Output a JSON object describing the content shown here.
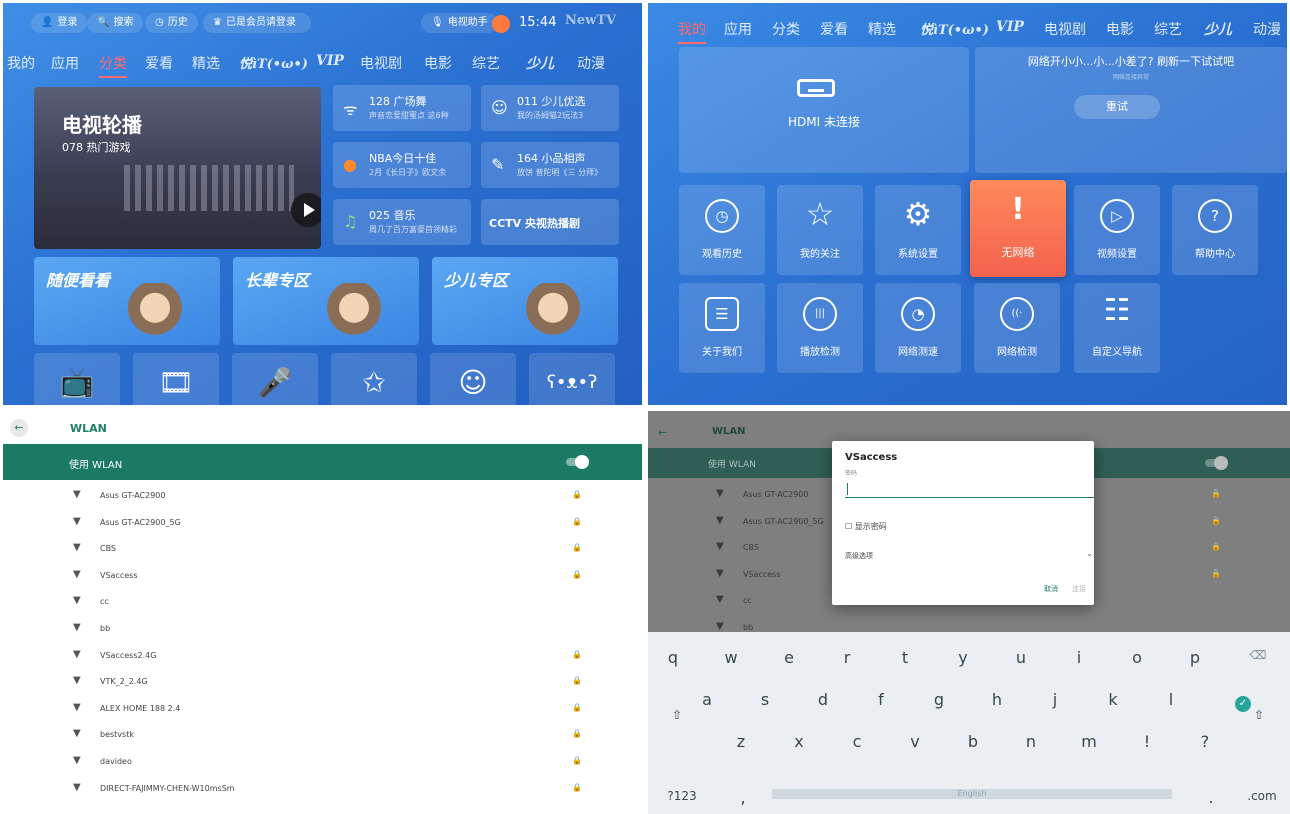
{
  "q1": {
    "status": {
      "login": "登录",
      "search": "搜索",
      "history": "历史",
      "member": "已是会员请登录",
      "assistant": "电视助手",
      "time": "15:44",
      "brand": "NewTV"
    },
    "nav": [
      "我的",
      "应用",
      "分类",
      "爱看",
      "精选",
      "悦ìT(•ω•)",
      "VIP",
      "电视剧",
      "电影",
      "综艺",
      "少儿",
      "动漫"
    ],
    "active_nav": "分类",
    "hero": {
      "title": "电视轮播",
      "subtitle": "078 热门游戏"
    },
    "tiles": [
      {
        "icon": "wifi-icon",
        "title": "128 广场舞",
        "sub": "声音恋爱甜蜜点 这6种"
      },
      {
        "icon": "smiley-icon",
        "title": "011 少儿优选",
        "sub": "我的汤姆猫2玩法3"
      },
      {
        "icon": "basketball-icon",
        "title": "NBA今日十佳",
        "sub": "2月《长日子》欧文余"
      },
      {
        "icon": "mic-icon",
        "title": "164 小品相声",
        "sub": "放饼 普陀明《三 分拜》"
      },
      {
        "icon": "music-icon",
        "title": "025 音乐",
        "sub": "周几了百万富豪首领精彩"
      },
      {
        "icon": "cctv-icon",
        "title": "CCTV 央视热播剧",
        "sub": ""
      }
    ],
    "zones": [
      {
        "title": "随便看看"
      },
      {
        "title": "长辈专区"
      },
      {
        "title": "少儿专区"
      }
    ],
    "categories": [
      {
        "icon": "tv-icon",
        "glyph": "📺"
      },
      {
        "icon": "film-reel-icon",
        "glyph": "🎞"
      },
      {
        "icon": "microphone-icon",
        "glyph": "🎤"
      },
      {
        "icon": "star-icon",
        "glyph": "✩"
      },
      {
        "icon": "face-icon",
        "glyph": "☺"
      },
      {
        "icon": "bear-icon",
        "glyph": "ʕ•ᴥ•ʔ"
      }
    ]
  },
  "q2": {
    "nav": [
      "我的",
      "应用",
      "分类",
      "爱看",
      "精选",
      "悦ìT(•ω•)",
      "VIP",
      "电视剧",
      "电影",
      "综艺",
      "少儿",
      "动漫"
    ],
    "active_nav": "我的",
    "hdmi": "HDMI 未连接",
    "network_msg": "网络开小小...小...小差了? 刷新一下试试吧",
    "network_sub": "网络连接异常",
    "retry": "重试",
    "settings": [
      {
        "icon": "clock-icon",
        "glyph": "◷",
        "label": "观看历史"
      },
      {
        "icon": "star-icon",
        "glyph": "☆",
        "label": "我的关注"
      },
      {
        "icon": "gear-icon",
        "glyph": "⚙",
        "label": "系统设置"
      },
      {
        "icon": "no-wifi-icon",
        "glyph": "!",
        "label": "无网络"
      },
      {
        "icon": "play-icon",
        "glyph": "▷",
        "label": "视频设置"
      },
      {
        "icon": "help-icon",
        "glyph": "?",
        "label": "帮助中心"
      },
      {
        "icon": "document-icon",
        "glyph": "☰",
        "label": "关于我们"
      },
      {
        "icon": "playback-test-icon",
        "glyph": "|||",
        "label": "播放检测"
      },
      {
        "icon": "speed-test-icon",
        "glyph": "◔",
        "label": "网络测速"
      },
      {
        "icon": "network-test-icon",
        "glyph": "((·",
        "label": "网络检测"
      },
      {
        "icon": "sliders-icon",
        "glyph": "☷",
        "label": "自定义导航"
      }
    ]
  },
  "q3": {
    "title": "WLAN",
    "enable_label": "使用 WLAN",
    "networks": [
      {
        "ssid": "Asus GT-AC2900",
        "locked": true
      },
      {
        "ssid": "Asus GT-AC2900_5G",
        "locked": true
      },
      {
        "ssid": "CBS",
        "locked": true
      },
      {
        "ssid": "VSaccess",
        "locked": true
      },
      {
        "ssid": "cc",
        "locked": false
      },
      {
        "ssid": "bb",
        "locked": false
      },
      {
        "ssid": "VSaccess2.4G",
        "locked": true
      },
      {
        "ssid": "VTK_2_2.4G",
        "locked": true
      },
      {
        "ssid": "ALEX HOME 188 2.4",
        "locked": true
      },
      {
        "ssid": "bestvstk",
        "locked": true
      },
      {
        "ssid": "davideo",
        "locked": true
      },
      {
        "ssid": "DIRECT-FAJIMMY-CHEN-W10msSm",
        "locked": true
      }
    ]
  },
  "q4": {
    "title": "WLAN",
    "enable_label": "使用 WLAN",
    "networks": [
      {
        "ssid": "Asus GT-AC2900",
        "locked": true
      },
      {
        "ssid": "Asus GT-AC2900_5G",
        "locked": true
      },
      {
        "ssid": "CBS",
        "locked": true
      },
      {
        "ssid": "VSaccess",
        "locked": true
      },
      {
        "ssid": "cc",
        "locked": false
      },
      {
        "ssid": "bb",
        "locked": false
      }
    ],
    "dialog": {
      "title": "VSaccess",
      "password_label": "密码",
      "password_value": "",
      "show_password": "显示密码",
      "advanced": "高级选项",
      "cancel": "取消",
      "connect": "连接"
    },
    "keyboard": {
      "row1": [
        "q",
        "w",
        "e",
        "r",
        "t",
        "y",
        "u",
        "i",
        "o",
        "p"
      ],
      "row2": [
        "a",
        "s",
        "d",
        "f",
        "g",
        "h",
        "j",
        "k",
        "l"
      ],
      "row3": [
        "z",
        "x",
        "c",
        "v",
        "b",
        "n",
        "m",
        "!",
        "?"
      ],
      "sym": "?123",
      "comma": ",",
      "space": "English",
      "period": ".",
      "dotcom": ".com",
      "backspace_glyph": "⌫",
      "enter_glyph": "✓",
      "shift_glyph": "⇧"
    }
  }
}
